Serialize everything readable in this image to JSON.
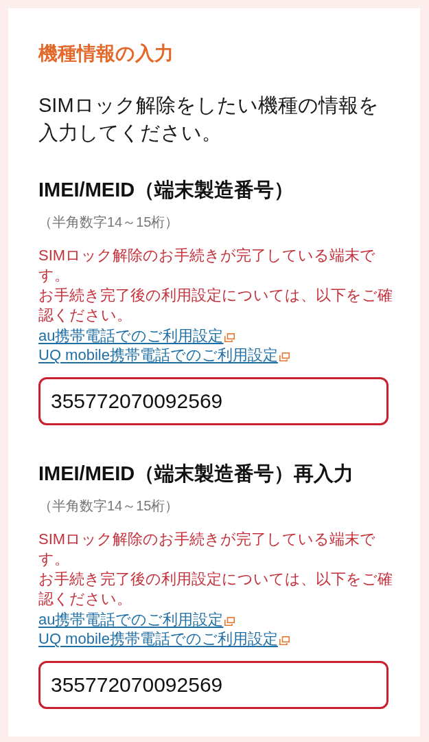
{
  "section_title": "機種情報の入力",
  "intro": "SIMロック解除をしたい機種の情報を入力してください。",
  "fields": [
    {
      "label": "IMEI/MEID（端末製造番号）",
      "hint": "（半角数字14～15桁）",
      "error": true,
      "messages": [
        "SIMロック解除のお手続きが完了している端末です。",
        "お手続き完了後の利用設定については、以下をご確認ください。"
      ],
      "links": [
        {
          "text": "au携帯電話でのご利用設定",
          "external": true
        },
        {
          "text": "UQ mobile携帯電話でのご利用設定",
          "external": true
        }
      ],
      "value": "355772070092569"
    },
    {
      "label": "IMEI/MEID（端末製造番号）再入力",
      "hint": "（半角数字14～15桁）",
      "error": true,
      "messages": [
        "SIMロック解除のお手続きが完了している端末です。",
        "お手続き完了後の利用設定については、以下をご確認ください。"
      ],
      "links": [
        {
          "text": "au携帯電話でのご利用設定",
          "external": true
        },
        {
          "text": "UQ mobile携帯電話でのご利用設定",
          "external": true
        }
      ],
      "value": "355772070092569"
    }
  ]
}
